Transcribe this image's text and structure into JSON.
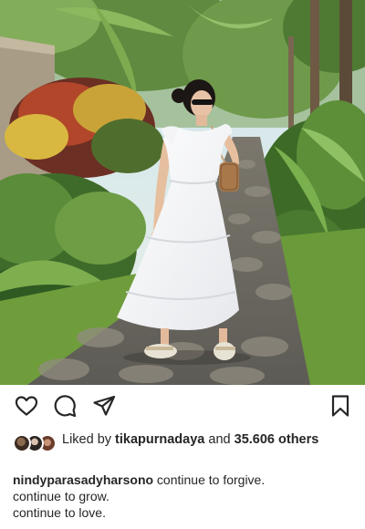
{
  "post": {
    "photo_alt": "",
    "icons": {
      "like": "heart-icon",
      "comment": "comment-icon",
      "share": "send-icon",
      "save": "bookmark-icon"
    },
    "likes": {
      "prefix": "Liked by ",
      "user": "tikapurnadaya",
      "middle": " and ",
      "count": "35.606",
      "suffix": " others"
    },
    "caption": {
      "username": "nindyparasadyharsono",
      "line1": " continue to forgive.",
      "line2": "continue to grow.",
      "line3": "continue to love."
    }
  }
}
